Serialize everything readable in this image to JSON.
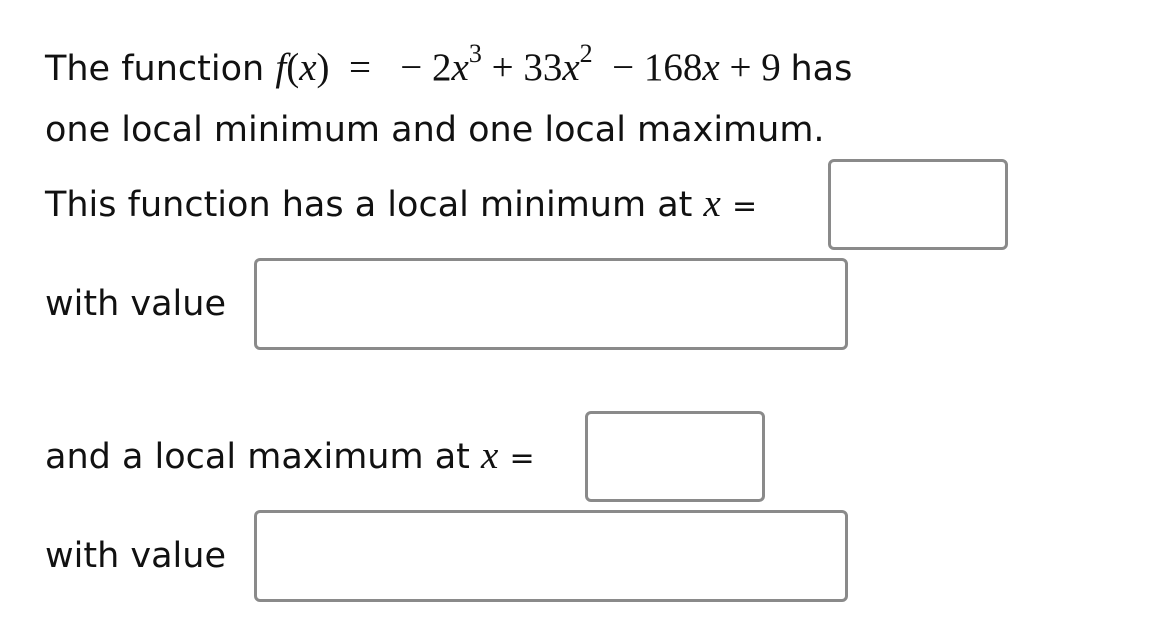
{
  "question": {
    "intro": "The function",
    "function_lhs_name": "f",
    "function_lhs_var": "x",
    "equals": "=",
    "terms": {
      "t1_sign": "−",
      "t1_coef": "2",
      "t1_var": "x",
      "t1_exp": "3",
      "t2_sign": "+",
      "t2_coef": "33",
      "t2_var": "x",
      "t2_exp": "2",
      "t3_sign": "−",
      "t3_coef": "168",
      "t3_var": "x",
      "t4_sign": "+",
      "t4_const": "9"
    },
    "suffix": "has",
    "line2": "one local minimum and one local maximum."
  },
  "min_section": {
    "prompt": "This function has a local minimum at",
    "var": "x",
    "equals": "=",
    "x_value": "",
    "with_value_label": "with value",
    "value": ""
  },
  "max_section": {
    "prompt": "and a local maximum at",
    "var": "x",
    "equals": "=",
    "x_value": "",
    "with_value_label": "with value",
    "value": ""
  }
}
